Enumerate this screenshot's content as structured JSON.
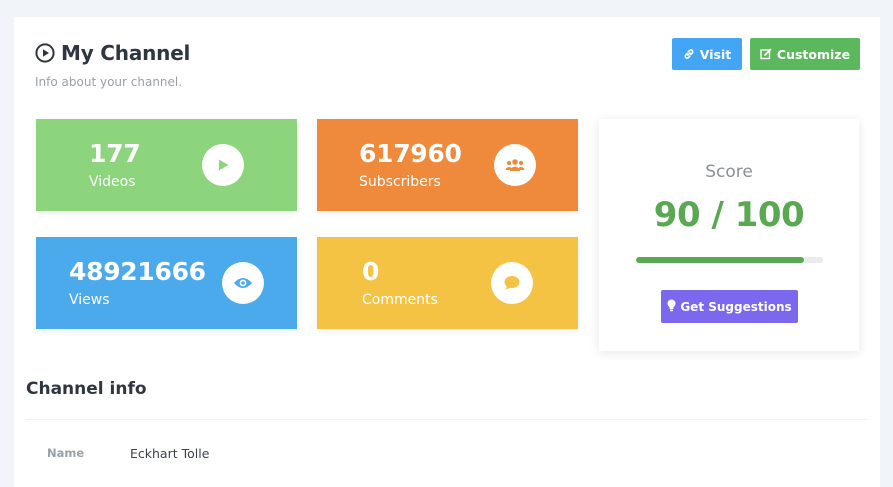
{
  "header": {
    "title": "My Channel",
    "subtitle": "Info about your channel.",
    "visit_label": "Visit",
    "customize_label": "Customize"
  },
  "stats": {
    "videos": {
      "value": "177",
      "label": "Videos",
      "color": "#8cd57d",
      "icon": "play-icon"
    },
    "subscribers": {
      "value": "617960",
      "label": "Subscribers",
      "color": "#ef8a3d",
      "icon": "users-icon"
    },
    "views": {
      "value": "48921666",
      "label": "Views",
      "color": "#4aaaeb",
      "icon": "eye-icon"
    },
    "comments": {
      "value": "0",
      "label": "Comments",
      "color": "#f5c343",
      "icon": "comment-icon"
    }
  },
  "score": {
    "label": "Score",
    "value": "90 / 100",
    "progress": 0.9,
    "suggest_label": "Get Suggestions"
  },
  "channel_info": {
    "title": "Channel info",
    "rows": [
      {
        "label": "Name",
        "value": "Eckhart Tolle"
      }
    ]
  },
  "colors": {
    "accent_green": "#5aa852",
    "visit_blue": "#42a5f5",
    "suggest_purple": "#7b68ee"
  }
}
